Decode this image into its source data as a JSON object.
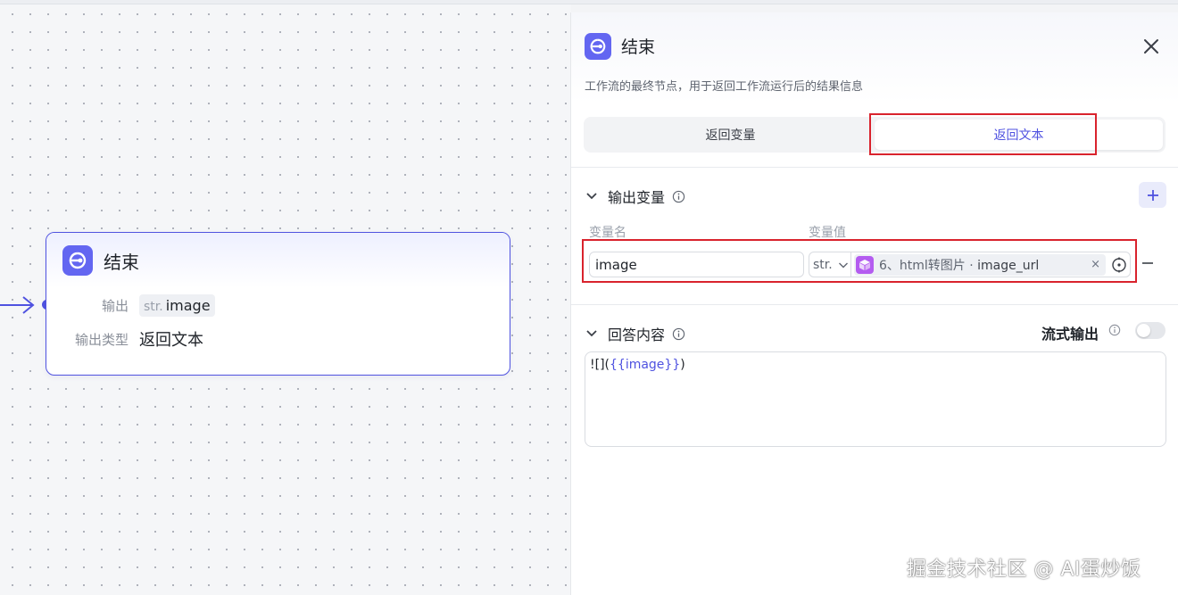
{
  "node": {
    "title": "结束",
    "output_label": "输出",
    "output_type_prefix": "str.",
    "output_value": "image",
    "output_kind_label": "输出类型",
    "output_kind_value": "返回文本"
  },
  "panel": {
    "title": "结束",
    "description": "工作流的最终节点，用于返回工作流运行后的结果信息",
    "tabs": [
      {
        "label": "返回变量",
        "active": false
      },
      {
        "label": "返回文本",
        "active": true
      }
    ],
    "output_section": {
      "title": "输出变量",
      "col_name": "变量名",
      "col_value": "变量值",
      "rows": [
        {
          "name": "image",
          "type": "str.",
          "ref_node": "6、html转图片",
          "ref_sep": " · ",
          "ref_field": "image_url"
        }
      ]
    },
    "answer_section": {
      "title": "回答内容",
      "stream_label": "流式输出",
      "stream_enabled": false,
      "content_prefix": "![](",
      "content_var": "{{image}}",
      "content_suffix": ")"
    }
  },
  "colors": {
    "accent": "#4f52e0",
    "node_icon": "#6366f1",
    "ref_icon": "#b45cf0",
    "highlight_box": "#d9232d"
  },
  "watermark": "掘金技术社区 @ AI蛋炒饭"
}
